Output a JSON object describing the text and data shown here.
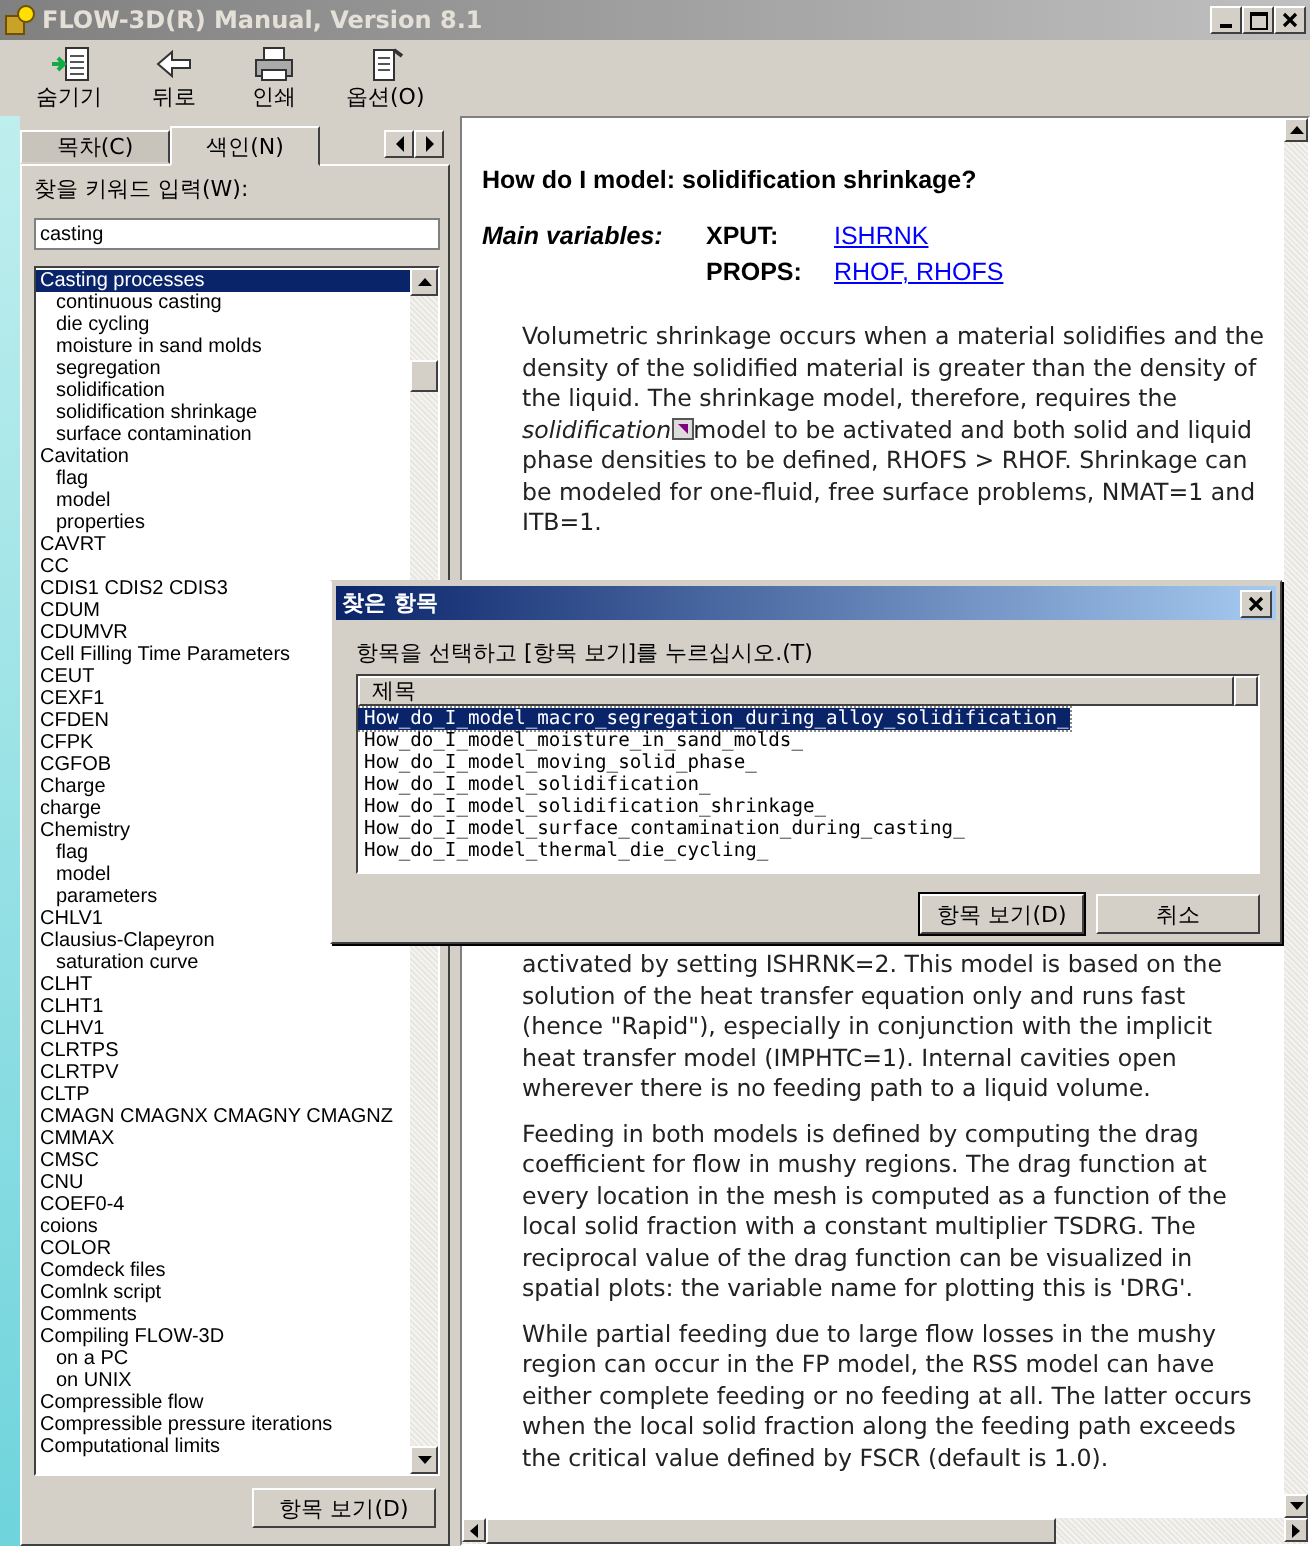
{
  "window": {
    "title": "FLOW-3D(R) Manual, Version 8.1"
  },
  "toolbar": [
    {
      "label": "숨기기",
      "kind": "hide"
    },
    {
      "label": "뒤로",
      "kind": "back"
    },
    {
      "label": "인쇄",
      "kind": "print"
    },
    {
      "label": "옵션(O)",
      "kind": "options"
    }
  ],
  "nav": {
    "tabs": [
      {
        "label": "목차(C)",
        "selected": false
      },
      {
        "label": "색인(N)",
        "selected": true
      }
    ],
    "keyword_label": "찾을 키워드 입력(W):",
    "keyword": "casting",
    "index": [
      {
        "label": "Casting processes",
        "selected": true,
        "children": [
          {
            "label": "continuous casting",
            "selected": false
          },
          {
            "label": "die cycling",
            "selected": false
          },
          {
            "label": "moisture in sand molds",
            "selected": false
          },
          {
            "label": "segregation",
            "selected": false
          },
          {
            "label": "solidification",
            "selected": false
          },
          {
            "label": "solidification shrinkage",
            "selected": false
          },
          {
            "label": "surface contamination",
            "selected": false
          }
        ]
      },
      {
        "label": "Cavitation",
        "selected": false,
        "children": [
          {
            "label": "flag",
            "selected": false
          },
          {
            "label": "model",
            "selected": false
          },
          {
            "label": "properties",
            "selected": false
          }
        ]
      },
      {
        "label": "CAVRT",
        "selected": false
      },
      {
        "label": "CC",
        "selected": false
      },
      {
        "label": "CDIS1 CDIS2 CDIS3",
        "selected": false
      },
      {
        "label": "CDUM",
        "selected": false
      },
      {
        "label": "CDUMVR",
        "selected": false
      },
      {
        "label": "Cell Filling Time Parameters",
        "selected": false
      },
      {
        "label": "CEUT",
        "selected": false
      },
      {
        "label": "CEXF1",
        "selected": false
      },
      {
        "label": "CFDEN",
        "selected": false
      },
      {
        "label": "CFPK",
        "selected": false
      },
      {
        "label": "CGFOB",
        "selected": false
      },
      {
        "label": "Charge",
        "selected": false
      },
      {
        "label": "charge",
        "selected": false
      },
      {
        "label": "Chemistry",
        "selected": false,
        "children": [
          {
            "label": "flag",
            "selected": false
          },
          {
            "label": "model",
            "selected": false
          },
          {
            "label": "parameters",
            "selected": false
          }
        ]
      },
      {
        "label": "CHLV1",
        "selected": false
      },
      {
        "label": "Clausius-Clapeyron",
        "selected": false,
        "children": [
          {
            "label": "saturation curve",
            "selected": false
          }
        ]
      },
      {
        "label": "CLHT",
        "selected": false
      },
      {
        "label": "CLHT1",
        "selected": false
      },
      {
        "label": "CLHV1",
        "selected": false
      },
      {
        "label": "CLRTPS",
        "selected": false
      },
      {
        "label": "CLRTPV",
        "selected": false
      },
      {
        "label": "CLTP",
        "selected": false
      },
      {
        "label": "CMAGN CMAGNX CMAGNY CMAGNZ",
        "selected": false
      },
      {
        "label": "CMMAX",
        "selected": false
      },
      {
        "label": "CMSC",
        "selected": false
      },
      {
        "label": "CNU",
        "selected": false
      },
      {
        "label": "COEF0-4",
        "selected": false
      },
      {
        "label": "coions",
        "selected": false
      },
      {
        "label": "COLOR",
        "selected": false
      },
      {
        "label": "Comdeck files",
        "selected": false
      },
      {
        "label": "Comlnk script",
        "selected": false
      },
      {
        "label": "Comments",
        "selected": false
      },
      {
        "label": "Compiling FLOW-3D",
        "selected": false,
        "children": [
          {
            "label": "on a PC",
            "selected": false
          },
          {
            "label": "on UNIX",
            "selected": false
          }
        ]
      },
      {
        "label": "Compressible flow",
        "selected": false
      },
      {
        "label": "Compressible pressure iterations",
        "selected": false
      },
      {
        "label": "Computational limits",
        "selected": false
      }
    ],
    "display_button": "항목 보기(D)"
  },
  "topic": {
    "title": "How do I model: solidification shrinkage?",
    "vars_label": "Main variables:",
    "variables": [
      {
        "name": "XPUT:",
        "link": "ISHRNK"
      },
      {
        "name": "PROPS:",
        "link": "RHOF, RHOFS"
      }
    ],
    "intro": {
      "before": "Volumetric shrinkage occurs when a material solidifies and the density of the solidified material is greater than the density of the liquid. The shrinkage model, therefore, requires the *solidification*",
      "after": "model to be activated and both solid and liquid phase densities to be defined, RHOFS > RHOF. Shrinkage can be modeled for one-fluid, free surface problems, NMAT=1 and ITB=1."
    },
    "paragraphs": [
      "activated by setting ISHRNK=2. This model is based on the solution of the heat transfer equation only and runs fast (hence \"Rapid\"), especially in conjunction with the implicit heat transfer model (IMPHTC=1). Internal cavities open wherever there is no feeding path to a liquid volume.",
      "Feeding in both models is defined by computing the drag coefficient for flow in mushy regions. The drag function at every location in the mesh is computed as a function of the local solid fraction with a constant multiplier TSDRG. The reciprocal value of the drag function can be visualized in spatial plots: the variable name for plotting this is 'DRG'.",
      "While partial feeding due to large flow losses in the mushy region can occur in the FP model, the RSS model can have either complete feeding or no feeding at all. The latter occurs when the local solid fraction along the feeding path exceeds the critical value defined by FSCR (default is 1.0)."
    ]
  },
  "dialog": {
    "title": "찾은 항목",
    "prompt": "항목을 선택하고 [항목 보기]를 누르십시오.(T)",
    "column": "제목",
    "topics": [
      {
        "label": "How_do_I_model_macro_segregation_during_alloy_solidification_",
        "selected": true
      },
      {
        "label": "How_do_I_model_moisture_in_sand_molds_",
        "selected": false
      },
      {
        "label": "How_do_I_model_moving_solid_phase_",
        "selected": false
      },
      {
        "label": "How_do_I_model_solidification_",
        "selected": false
      },
      {
        "label": "How_do_I_model_solidification_shrinkage_",
        "selected": false
      },
      {
        "label": "How_do_I_model_surface_contamination_during_casting_",
        "selected": false
      },
      {
        "label": "How_do_I_model_thermal_die_cycling_",
        "selected": false
      }
    ],
    "buttons": [
      "항목 보기(D)",
      "취소"
    ]
  }
}
